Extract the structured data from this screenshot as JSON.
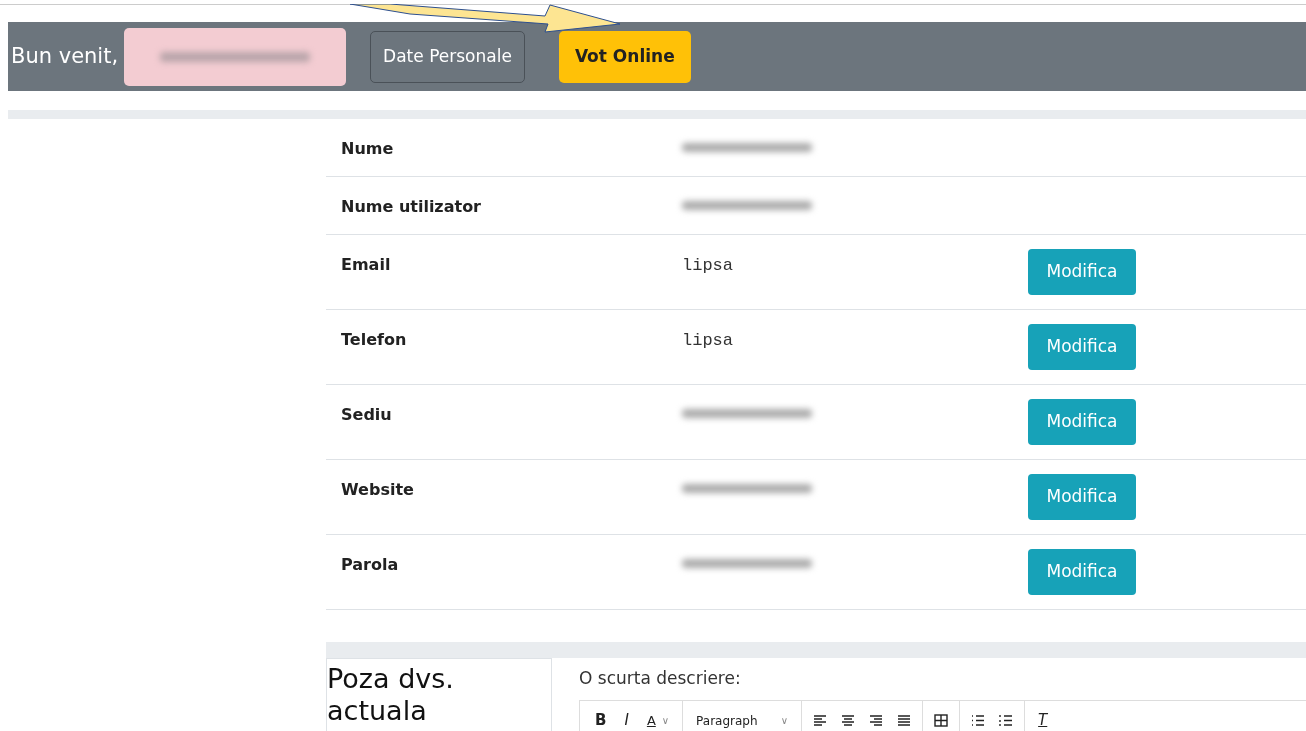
{
  "navbar": {
    "greeting": "Bun venit,",
    "user_redacted": true,
    "buttons": [
      {
        "label": "Date Personale",
        "kind": "outline"
      },
      {
        "label": "Vot Online",
        "kind": "warning"
      }
    ]
  },
  "annotation": {
    "kind": "arrow"
  },
  "profile_rows": [
    {
      "label": "Nume",
      "redacted": true,
      "action": null
    },
    {
      "label": "Nume utilizator",
      "redacted": true,
      "action": null
    },
    {
      "label": "Email",
      "value": "lipsa",
      "action": "Modifica"
    },
    {
      "label": "Telefon",
      "value": "lipsa",
      "action": "Modifica"
    },
    {
      "label": "Sediu",
      "redacted": true,
      "action": "Modifica"
    },
    {
      "label": "Website",
      "redacted": true,
      "action": "Modifica"
    },
    {
      "label": "Parola",
      "redacted": true,
      "action": "Modifica"
    }
  ],
  "photo_section": {
    "title": "Poza dvs. actuala"
  },
  "description": {
    "label": "O scurta descriere:",
    "toolbar": [
      {
        "kind": "bold",
        "text": "B"
      },
      {
        "kind": "italic",
        "text": "I"
      },
      {
        "kind": "color",
        "text": "A",
        "chevron": "∨"
      },
      {
        "kind": "sep"
      },
      {
        "kind": "select",
        "text": "Paragraph",
        "chevron": "∨"
      },
      {
        "kind": "sep"
      },
      {
        "kind": "align-left"
      },
      {
        "kind": "align-center"
      },
      {
        "kind": "align-right"
      },
      {
        "kind": "align-justify"
      },
      {
        "kind": "sep"
      },
      {
        "kind": "table"
      },
      {
        "kind": "sep"
      },
      {
        "kind": "bullets"
      },
      {
        "kind": "numbers"
      },
      {
        "kind": "sep"
      },
      {
        "kind": "clear",
        "text": "T"
      }
    ]
  }
}
